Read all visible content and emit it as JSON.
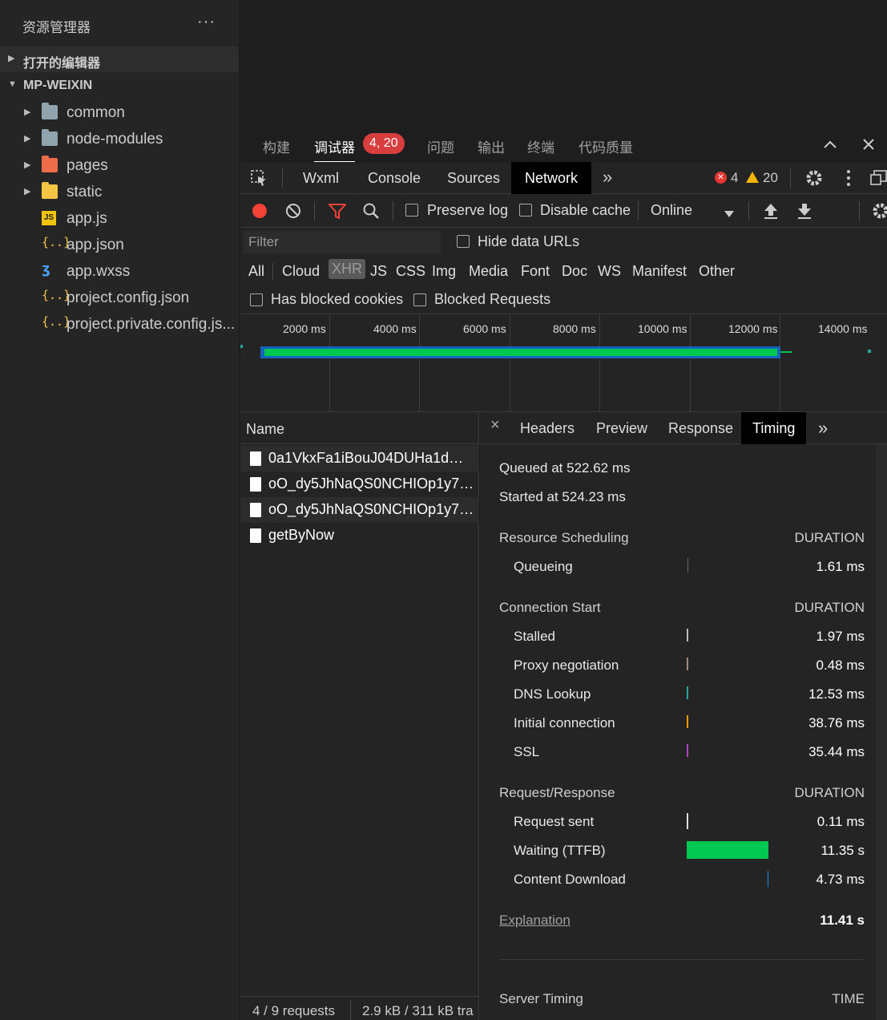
{
  "explorer": {
    "title": "资源管理器",
    "more": "···",
    "sections": [
      {
        "label": "打开的编辑器",
        "expanded": false
      },
      {
        "label": "MP-WEIXIN",
        "expanded": true
      }
    ],
    "items": [
      {
        "label": "common",
        "icon": "folder-icon",
        "arrow": "▶"
      },
      {
        "label": "node-modules",
        "icon": "folder-icon",
        "arrow": "▶"
      },
      {
        "label": "pages",
        "icon": "folder-pages-icon",
        "arrow": "▶"
      },
      {
        "label": "static",
        "icon": "folder-static-icon",
        "arrow": "▶"
      },
      {
        "label": "app.js",
        "icon": "js-file-icon",
        "glyph": "JS"
      },
      {
        "label": "app.json",
        "icon": "json-file-icon",
        "glyph": "{..}"
      },
      {
        "label": "app.wxss",
        "icon": "css-file-icon",
        "glyph": "ʒ"
      },
      {
        "label": "project.config.json",
        "icon": "json-file-icon",
        "glyph": "{..}"
      },
      {
        "label": "project.private.config.js...",
        "icon": "json-file-icon",
        "glyph": "{..}"
      }
    ]
  },
  "panel_tabs": {
    "items": [
      "构建",
      "调试器",
      "问题",
      "输出",
      "终端",
      "代码质量"
    ],
    "active": "调试器",
    "badge": "4, 20"
  },
  "devtools_tabs": {
    "items": [
      "Wxml",
      "Console",
      "Sources",
      "Network"
    ],
    "active": "Network",
    "overflow": "»",
    "errors": "4",
    "warnings": "20"
  },
  "network_toolbar": {
    "preserve_log": "Preserve log",
    "disable_cache": "Disable cache",
    "throttle": "Online"
  },
  "filter": {
    "placeholder": "Filter",
    "hide_data_urls": "Hide data URLs"
  },
  "types": [
    "All",
    "Cloud",
    "XHR",
    "JS",
    "CSS",
    "Img",
    "Media",
    "Font",
    "Doc",
    "WS",
    "Manifest",
    "Other"
  ],
  "selected_type": "XHR",
  "cookie_filters": {
    "blocked_cookies": "Has blocked cookies",
    "blocked_requests": "Blocked Requests"
  },
  "overview": {
    "ticks": [
      "2000 ms",
      "4000 ms",
      "6000 ms",
      "8000 ms",
      "10000 ms",
      "12000 ms",
      "14000 ms"
    ],
    "colors": {
      "waiting": "#00c853",
      "download": "#1e88e5"
    }
  },
  "requests": {
    "header": "Name",
    "rows": [
      "0a1VkxFa1iBouJ04DUHa1dMp...",
      "oO_dy5JhNaQS0NCHIOp1y79...",
      "oO_dy5JhNaQS0NCHIOp1y79...",
      "getByNow"
    ],
    "footer_count": "4 / 9 requests",
    "footer_size": "2.9 kB / 311 kB tra"
  },
  "detail_tabs": {
    "close": "×",
    "items": [
      "Headers",
      "Preview",
      "Response",
      "Timing"
    ],
    "active": "Timing",
    "overflow": "»"
  },
  "timing": {
    "queued": "Queued at 522.62 ms",
    "started": "Started at 524.23 ms",
    "duration_label": "DURATION",
    "sections": [
      {
        "title": "Resource Scheduling",
        "rows": [
          {
            "label": "Queueing",
            "value": "1.61 ms",
            "color": "#9e9e9e"
          }
        ]
      },
      {
        "title": "Connection Start",
        "rows": [
          {
            "label": "Stalled",
            "value": "1.97 ms",
            "color": "#bdbdbd"
          },
          {
            "label": "Proxy negotiation",
            "value": "0.48 ms",
            "color": "#a1887f"
          },
          {
            "label": "DNS Lookup",
            "value": "12.53 ms",
            "color": "#26a69a"
          },
          {
            "label": "Initial connection",
            "value": "38.76 ms",
            "color": "#ff9800"
          },
          {
            "label": "SSL",
            "value": "35.44 ms",
            "color": "#ab47bc"
          }
        ]
      },
      {
        "title": "Request/Response",
        "rows": [
          {
            "label": "Request sent",
            "value": "0.11 ms",
            "color": "#e0e0e0"
          },
          {
            "label": "Waiting (TTFB)",
            "value": "11.35 s",
            "color": "#00c853"
          },
          {
            "label": "Content Download",
            "value": "4.73 ms",
            "color": "#1e88e5"
          }
        ]
      }
    ],
    "explanation": "Explanation",
    "total": "11.41 s",
    "server_timing": "Server Timing",
    "time_label": "TIME"
  }
}
